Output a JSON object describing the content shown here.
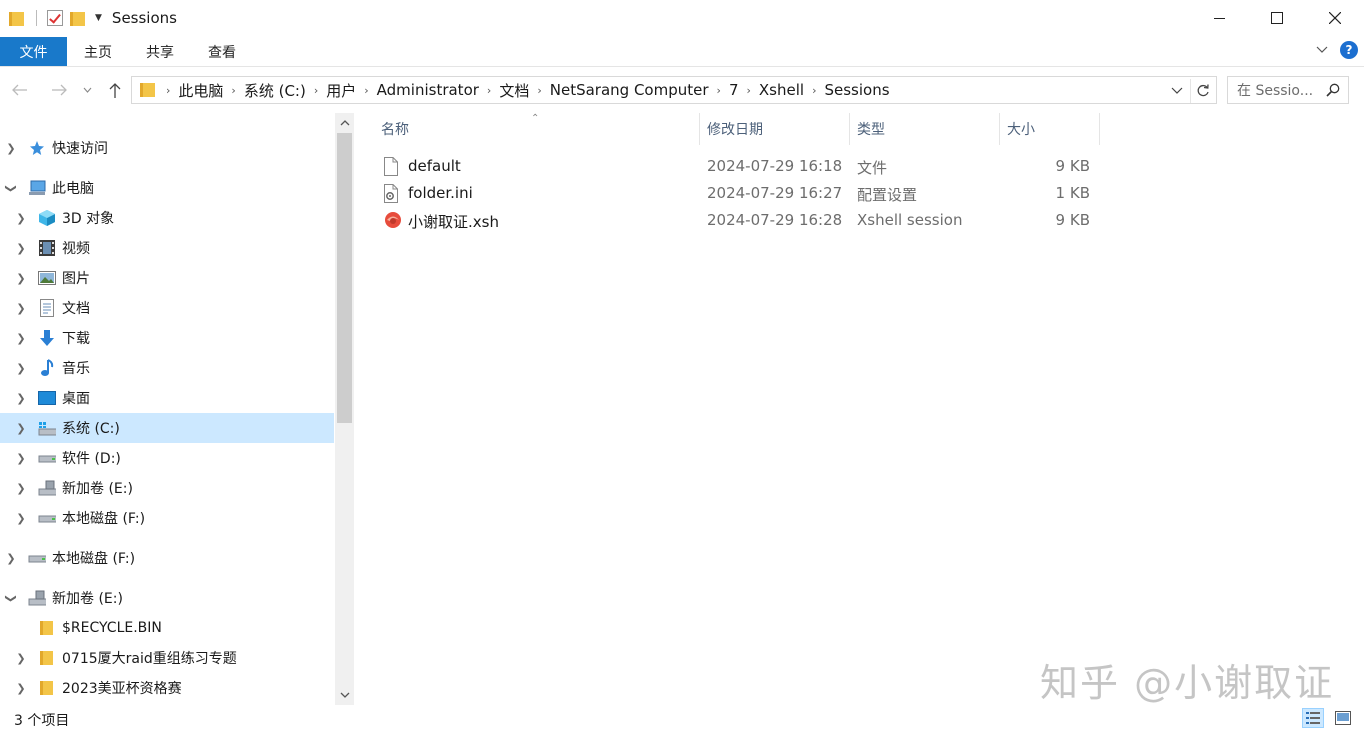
{
  "window": {
    "title": "Sessions"
  },
  "ribbon": {
    "tabs": [
      "文件",
      "主页",
      "共享",
      "查看"
    ]
  },
  "breadcrumb": [
    "此电脑",
    "系统 (C:)",
    "用户",
    "Administrator",
    "文档",
    "NetSarang Computer",
    "7",
    "Xshell",
    "Sessions"
  ],
  "search": {
    "placeholder": "在 Sessio..."
  },
  "nav": {
    "items": [
      {
        "label": "快速访问",
        "icon": "star-icon"
      },
      {
        "label": "此电脑",
        "icon": "computer-icon"
      },
      {
        "label": "3D 对象",
        "icon": "cube-icon"
      },
      {
        "label": "视频",
        "icon": "film-icon"
      },
      {
        "label": "图片",
        "icon": "picture-icon"
      },
      {
        "label": "文档",
        "icon": "document-icon"
      },
      {
        "label": "下载",
        "icon": "download-icon"
      },
      {
        "label": "音乐",
        "icon": "music-icon"
      },
      {
        "label": "桌面",
        "icon": "desktop-icon"
      },
      {
        "label": "系统 (C:)",
        "icon": "system-drive-icon"
      },
      {
        "label": "软件 (D:)",
        "icon": "drive-icon"
      },
      {
        "label": "新加卷 (E:)",
        "icon": "usb-drive-icon"
      },
      {
        "label": "本地磁盘 (F:)",
        "icon": "drive-icon"
      },
      {
        "label": "本地磁盘 (F:)",
        "icon": "drive-icon"
      },
      {
        "label": "新加卷 (E:)",
        "icon": "usb-drive-icon"
      },
      {
        "label": "$RECYCLE.BIN",
        "icon": "folder-icon"
      },
      {
        "label": "0715厦大raid重组练习专题",
        "icon": "folder-icon"
      },
      {
        "label": "2023美亚杯资格赛",
        "icon": "folder-icon"
      }
    ]
  },
  "columns": {
    "name": "名称",
    "date": "修改日期",
    "type": "类型",
    "size": "大小"
  },
  "files": [
    {
      "name": "default",
      "date": "2024-07-29 16:18",
      "type": "文件",
      "size": "9 KB",
      "icon": "blank-file-icon"
    },
    {
      "name": "folder.ini",
      "date": "2024-07-29 16:27",
      "type": "配置设置",
      "size": "1 KB",
      "icon": "config-file-icon"
    },
    {
      "name": "小谢取证.xsh",
      "date": "2024-07-29 16:28",
      "type": "Xshell session",
      "size": "9 KB",
      "icon": "xshell-session-icon"
    }
  ],
  "status": {
    "item_count": "3 个项目"
  },
  "watermark": "知乎 @小谢取证",
  "colors": {
    "accent": "#1979ca",
    "selection": "#cce8ff",
    "folder": "#f3c548",
    "header_text": "#4c607a"
  }
}
